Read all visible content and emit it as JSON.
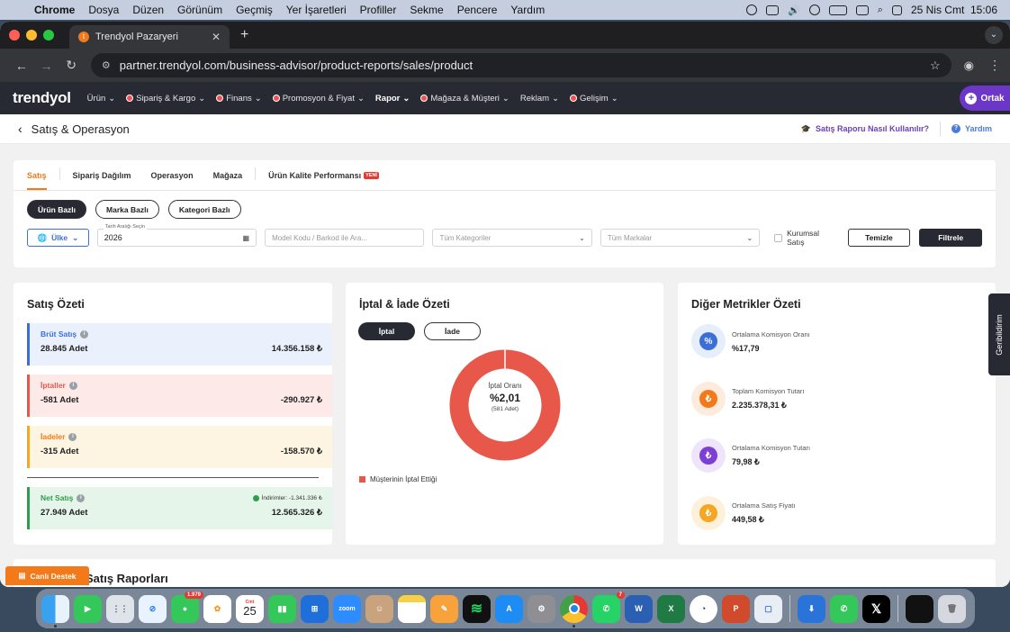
{
  "menubar": {
    "apple": "",
    "items": [
      "Chrome",
      "Dosya",
      "Düzen",
      "Görünüm",
      "Geçmiş",
      "Yer İşaretleri",
      "Profiller",
      "Sekme",
      "Pencere",
      "Yardım"
    ],
    "datetime": "25 Nis Cmt  15:06"
  },
  "browser": {
    "tab_title": "Trendyol Pazaryeri",
    "url": "partner.trendyol.com/business-advisor/product-reports/sales/product"
  },
  "topnav": {
    "logo": "trendyol",
    "items": [
      {
        "label": "Ürün",
        "dot": false
      },
      {
        "label": "Sipariş & Kargo",
        "dot": true
      },
      {
        "label": "Finans",
        "dot": true
      },
      {
        "label": "Promosyon & Fiyat",
        "dot": true
      },
      {
        "label": "Rapor",
        "dot": false,
        "bold": true
      },
      {
        "label": "Mağaza & Müşteri",
        "dot": true
      },
      {
        "label": "Reklam",
        "dot": false
      },
      {
        "label": "Gelişim",
        "dot": true
      }
    ],
    "ortak_label": "Ortak"
  },
  "subheader": {
    "title": "Satış & Operasyon",
    "help_link": "Satış Raporu Nasıl Kullanılır?",
    "yardim": "Yardım"
  },
  "tabs": {
    "items": [
      "Satış",
      "Sipariş Dağılım",
      "Operasyon",
      "Mağaza",
      "Ürün Kalite Performansı"
    ],
    "new_badge": "YENİ"
  },
  "pills": [
    "Ürün Bazlı",
    "Marka Bazlı",
    "Kategori Bazlı"
  ],
  "filters": {
    "country": "Ülke",
    "date_label": "Tarih Aralığı Seçin",
    "date_value": "2026",
    "model_placeholder": "Model Kodu / Barkod ile Ara...",
    "category_placeholder": "Tüm Kategoriler",
    "brand_placeholder": "Tüm Markalar",
    "corporate_label": "Kurumsal Satış",
    "clear": "Temizle",
    "filter": "Filtrele"
  },
  "sales_summary": {
    "title": "Satış Özeti",
    "gross": {
      "label": "Brüt Satış",
      "qty": "28.845 Adet",
      "amount": "14.356.158 ₺"
    },
    "cancels": {
      "label": "İptaller",
      "qty": "-581 Adet",
      "amount": "-290.927 ₺"
    },
    "returns": {
      "label": "İadeler",
      "qty": "-315 Adet",
      "amount": "-158.570 ₺"
    },
    "net": {
      "label": "Net Satış",
      "discount": "İndirimler: -1.341.336 ₺",
      "qty": "27.949 Adet",
      "amount": "12.565.326 ₺"
    }
  },
  "cancel_summary": {
    "title": "İptal & İade Özeti",
    "toggle_cancel": "İptal",
    "toggle_return": "İade",
    "center_label": "İptal Oranı",
    "center_value": "%2,01",
    "center_sub": "(581 Adet)",
    "legend": "Müşterinin İptal Ettiği",
    "donut_share": 1.0,
    "donut_color": "#e8584a"
  },
  "other_metrics": {
    "title": "Diğer Metrikler Özeti",
    "items": [
      {
        "label": "Ortalama Komisyon Oranı",
        "value": "%17,79",
        "icon": "percent-icon",
        "color": "#3a6fd8",
        "bg": "#e6eefc",
        "glyph": "%"
      },
      {
        "label": "Toplam Komisyon Tutarı",
        "value": "2.235.378,31 ₺",
        "icon": "lira-icon",
        "color": "#f27a1a",
        "bg": "#fdebdd",
        "glyph": "₺"
      },
      {
        "label": "Ortalama Komisyon Tutarı",
        "value": "79,98 ₺",
        "icon": "lira-icon",
        "color": "#7b3fd6",
        "bg": "#eee4fb",
        "glyph": "₺"
      },
      {
        "label": "Ortalama Satış Fiyatı",
        "value": "449,58 ₺",
        "icon": "lira-icon",
        "color": "#f5a623",
        "bg": "#fdf1dc",
        "glyph": "₺"
      }
    ]
  },
  "bottom": {
    "title": "Satış Raporları"
  },
  "live_support": "Canlı Destek",
  "feedback": "Geribildirim",
  "dock": {
    "badges": {
      "messages": "1.979",
      "whatsapp": "7"
    },
    "calendar": {
      "month": "Cmt",
      "day": "25"
    },
    "zoom_label": "zoom"
  }
}
